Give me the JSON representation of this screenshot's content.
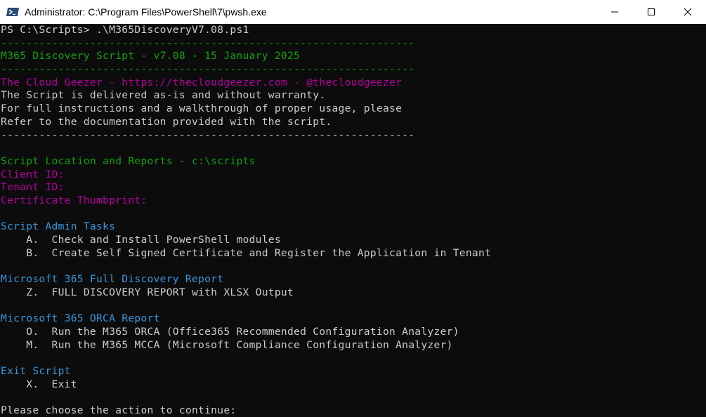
{
  "window": {
    "title": "Administrator: C:\\Program Files\\PowerShell\\7\\pwsh.exe",
    "icon": "powershell-icon",
    "controls": [
      "minimize-icon",
      "maximize-icon",
      "close-icon"
    ]
  },
  "colors": {
    "background": "#0c0c0c",
    "default_text": "#cccccc",
    "green": "#13a10e",
    "magenta": "#b4009e",
    "cyan": "#3a96dd"
  },
  "console": {
    "lines": [
      {
        "text": "PS C:\\Scripts> .\\M365DiscoveryV7.08.ps1",
        "color": "white"
      },
      {
        "text": "-----------------------------------------------------------------",
        "color": "green"
      },
      {
        "text": "M365 Discovery Script - v7.08 - 15 January 2025",
        "color": "green"
      },
      {
        "text": "-----------------------------------------------------------------",
        "color": "green"
      },
      {
        "text": "The Cloud Geezer - https://thecloudgeezer.com - @thecloudgeezer",
        "color": "magenta"
      },
      {
        "text": "The Script is delivered as-is and without warranty.",
        "color": "white"
      },
      {
        "text": "For full instructions and a walkthrough of proper usage, please",
        "color": "white"
      },
      {
        "text": "Refer to the documentation provided with the script.",
        "color": "white"
      },
      {
        "text": "-----------------------------------------------------------------",
        "color": "white"
      },
      {
        "text": "",
        "color": "white"
      },
      {
        "text": "Script Location and Reports - c:\\scripts",
        "color": "green"
      },
      {
        "text": "Client ID:",
        "color": "magenta"
      },
      {
        "text": "Tenant ID:",
        "color": "magenta"
      },
      {
        "text": "Certificate Thumbprint:",
        "color": "magenta"
      },
      {
        "text": "",
        "color": "white"
      },
      {
        "text": "Script Admin Tasks",
        "color": "cyan"
      },
      {
        "text": "    A.  Check and Install PowerShell modules",
        "color": "white"
      },
      {
        "text": "    B.  Create Self Signed Certificate and Register the Application in Tenant",
        "color": "white"
      },
      {
        "text": "",
        "color": "white"
      },
      {
        "text": "Microsoft 365 Full Discovery Report",
        "color": "cyan"
      },
      {
        "text": "    Z.  FULL DISCOVERY REPORT with XLSX Output",
        "color": "white"
      },
      {
        "text": "",
        "color": "white"
      },
      {
        "text": "Microsoft 365 ORCA Report",
        "color": "cyan"
      },
      {
        "text": "    O.  Run the M365 ORCA (Office365 Recommended Configuration Analyzer)",
        "color": "white"
      },
      {
        "text": "    M.  Run the M365 MCCA (Microsoft Compliance Configuration Analyzer)",
        "color": "white"
      },
      {
        "text": "",
        "color": "white"
      },
      {
        "text": "Exit Script",
        "color": "cyan"
      },
      {
        "text": "    X.  Exit",
        "color": "white"
      },
      {
        "text": "",
        "color": "white"
      },
      {
        "text": "Please choose the action to continue:",
        "color": "white"
      }
    ]
  }
}
